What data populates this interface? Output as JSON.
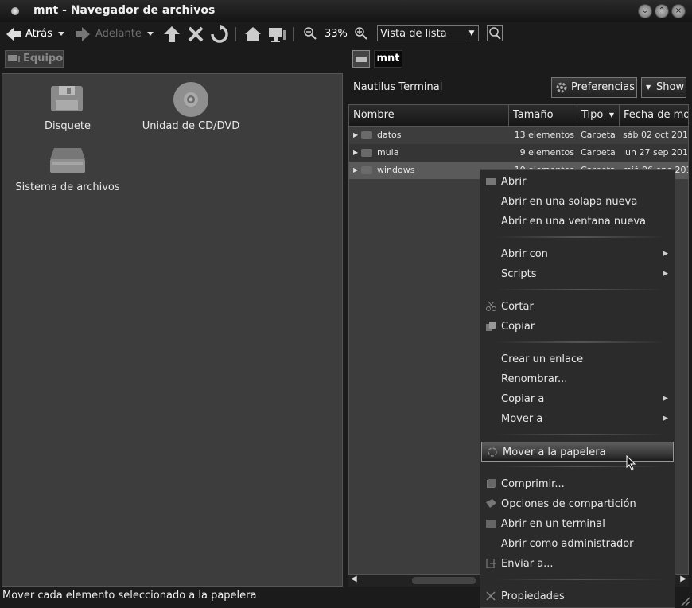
{
  "window": {
    "title": "mnt - Navegador de archivos"
  },
  "toolbar": {
    "back_label": "Atrás",
    "forward_label": "Adelante",
    "zoom_level": "33%",
    "view_mode": "Vista de lista"
  },
  "left_pane": {
    "header": "Equipo",
    "devices": [
      {
        "label": "Disquete",
        "icon": "floppy-icon"
      },
      {
        "label": "Unidad de CD/DVD",
        "icon": "cd-icon"
      },
      {
        "label": "Sistema de archivos",
        "icon": "harddisk-icon"
      }
    ]
  },
  "right_pane": {
    "path_current": "mnt",
    "terminal_label": "Nautilus Terminal",
    "preferences_label": "Preferencias",
    "show_label": "Show",
    "columns": [
      "Nombre",
      "Tamaño",
      "Tipo",
      "Fecha de mod"
    ],
    "rows": [
      {
        "name": "datos",
        "size": "13 elementos",
        "type": "Carpeta",
        "date": "sáb 02 oct 201"
      },
      {
        "name": "mula",
        "size": "9 elementos",
        "type": "Carpeta",
        "date": "lun 27 sep 201"
      },
      {
        "name": "windows",
        "size": "10 elementos",
        "type": "Carpeta",
        "date": "mié 06 ene 201"
      }
    ]
  },
  "status_bar": {
    "text": "Mover cada elemento seleccionado a la papelera"
  },
  "context_menu": {
    "items": [
      {
        "label": "Abrir"
      },
      {
        "label": "Abrir en una solapa nueva"
      },
      {
        "label": "Abrir en una ventana nueva"
      },
      {
        "label": "Abrir con"
      },
      {
        "label": "Scripts"
      },
      {
        "label": "Cortar"
      },
      {
        "label": "Copiar"
      },
      {
        "label": "Crear un enlace"
      },
      {
        "label": "Renombrar..."
      },
      {
        "label": "Copiar a"
      },
      {
        "label": "Mover a"
      },
      {
        "label": "Mover a la papelera"
      },
      {
        "label": "Comprimir..."
      },
      {
        "label": "Opciones de compartición"
      },
      {
        "label": "Abrir en un terminal"
      },
      {
        "label": "Abrir como administrador"
      },
      {
        "label": "Enviar a..."
      },
      {
        "label": "Propiedades"
      }
    ]
  }
}
